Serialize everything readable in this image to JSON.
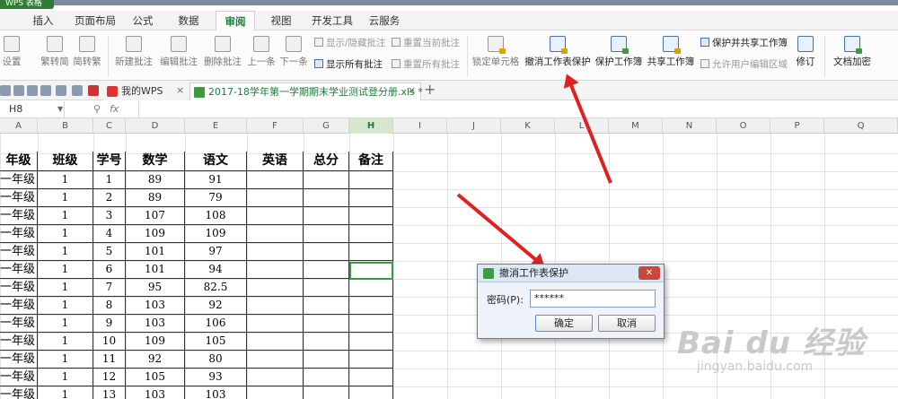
{
  "app_menu": {
    "label": "WPS 表格"
  },
  "tabs": [
    {
      "label": "插入"
    },
    {
      "label": "页面布局"
    },
    {
      "label": "公式"
    },
    {
      "label": "数据"
    },
    {
      "label": "审阅"
    },
    {
      "label": "视图"
    },
    {
      "label": "开发工具"
    },
    {
      "label": "云服务"
    }
  ],
  "active_tab": "审阅",
  "ribbon": {
    "spell_check": "设置",
    "trad_to_simp": "繁转简",
    "simp_to_trad": "简转繁",
    "new_comment": "新建批注",
    "edit_comment": "编辑批注",
    "delete_comment": "删除批注",
    "prev": "上一条",
    "next": "下一条",
    "show_hide_comment": "显示/隐藏批注",
    "show_all_comments": "显示所有批注",
    "reset_current_comment": "重置当前批注",
    "reset_all_comments": "重置所有批注",
    "lock_cell": "锁定单元格",
    "unprotect_sheet": "撤消工作表保护",
    "protect_workbook": "保护工作簿",
    "share_workbook": "共享工作簿",
    "protect_and_share": "保护并共享工作簿",
    "allow_edit_ranges": "允许用户编辑区域",
    "track_changes": "修订",
    "doc_encrypt": "文档加密"
  },
  "quickbar": {
    "doc_tab_1": "我的WPS",
    "doc_tab_2": "2017-18学年第一学期期末学业测试登分册.xls *",
    "close_glyph": "×",
    "add_glyph": "+"
  },
  "formula_bar": {
    "cell_ref": "H8",
    "fx": "fx",
    "value": ""
  },
  "columns": [
    "A",
    "B",
    "C",
    "D",
    "E",
    "F",
    "G",
    "H",
    "I",
    "J",
    "K",
    "L",
    "M",
    "N",
    "O",
    "P",
    "Q"
  ],
  "selected_column": "H",
  "table": {
    "headers": [
      "年级",
      "班级",
      "学号",
      "数学",
      "语文",
      "英语",
      "总分",
      "备注"
    ],
    "rows": [
      [
        "一年级",
        "1",
        "1",
        "89",
        "91",
        "",
        "",
        ""
      ],
      [
        "一年级",
        "1",
        "2",
        "89",
        "79",
        "",
        "",
        ""
      ],
      [
        "一年级",
        "1",
        "3",
        "107",
        "108",
        "",
        "",
        ""
      ],
      [
        "一年级",
        "1",
        "4",
        "109",
        "109",
        "",
        "",
        ""
      ],
      [
        "一年级",
        "1",
        "5",
        "101",
        "97",
        "",
        "",
        ""
      ],
      [
        "一年级",
        "1",
        "6",
        "101",
        "94",
        "",
        "",
        ""
      ],
      [
        "一年级",
        "1",
        "7",
        "95",
        "82.5",
        "",
        "",
        ""
      ],
      [
        "一年级",
        "1",
        "8",
        "103",
        "92",
        "",
        "",
        ""
      ],
      [
        "一年级",
        "1",
        "9",
        "103",
        "106",
        "",
        "",
        ""
      ],
      [
        "一年级",
        "1",
        "10",
        "109",
        "105",
        "",
        "",
        ""
      ],
      [
        "一年级",
        "1",
        "11",
        "92",
        "80",
        "",
        "",
        ""
      ],
      [
        "一年级",
        "1",
        "12",
        "105",
        "93",
        "",
        "",
        ""
      ],
      [
        "一年级",
        "1",
        "13",
        "103",
        "103",
        "",
        "",
        ""
      ]
    ]
  },
  "dialog": {
    "title": "撤消工作表保护",
    "close_glyph": "✕",
    "password_label": "密码(P):",
    "password_value": "******",
    "ok": "确定",
    "cancel": "取消"
  },
  "watermark": {
    "logo": "Bai du 经验",
    "url": "jingyan.baidu.com"
  },
  "colors": {
    "accent_green": "#1b7d3a",
    "annotation_red": "#e02020",
    "selection_green": "#3c9b3c"
  }
}
